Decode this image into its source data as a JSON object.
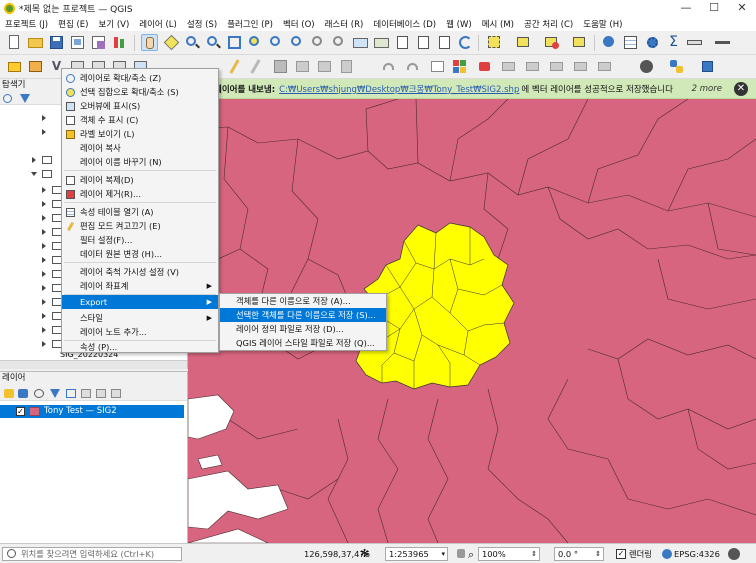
{
  "window": {
    "title": "*제목 없는 프로젝트 — QGIS"
  },
  "menubar": [
    "프로젝트 (J)",
    "편집 (E)",
    "보기 (V)",
    "레이어 (L)",
    "설정 (S)",
    "플러그인 (P)",
    "벡터 (O)",
    "래스터 (R)",
    "데이터베이스 (D)",
    "웹 (W)",
    "메시 (M)",
    "공간 처리 (C)",
    "도움말 (H)"
  ],
  "message": {
    "lead": "레이어를 내보냄:",
    "path": "C:₩Users₩shjung₩Desktop₩크몽₩Tony_Test₩SIG2.shp",
    "tail": "에 벡터 레이어를 성공적으로 저장했습니다",
    "more": "2 more"
  },
  "browser": {
    "title": "탐색기",
    "partial_item": "SIG_20220324"
  },
  "layers_panel": {
    "title": "레이어",
    "layer_name": "Tony Test — SIG2"
  },
  "context_menu": {
    "items": [
      "레이어로 확대/축소 (Z)",
      "선택 집합으로 확대/축소 (S)",
      "오버뷰에 표시(S)",
      "객체 수 표시 (C)",
      "라벨 보이기 (L)",
      "레이어 복사",
      "레이어 이름 바꾸기 (N)",
      "레이어 복제(D)",
      "레이어 제거(R)...",
      "속성 테이블 열기 (A)",
      "편집 모드 켜고끄기 (E)",
      "필터 설정(F)...",
      "데이터 원본 변경 (H)...",
      "레이어 축척 가시성 설정 (V)",
      "레이어 좌표계",
      "Export",
      "스타일",
      "레이어 노트 추가...",
      "속성 (P)..."
    ]
  },
  "export_submenu": {
    "items": [
      "객체를 다른 이름으로 저장 (A)...",
      "선택한 객체를 다른 이름으로 저장 (S)...",
      "레이어 정의 파일로 저장 (D)...",
      "QGIS 레이어 스타일 파일로 저장 (Q)..."
    ]
  },
  "statusbar": {
    "locate_placeholder": "위치를 찾으려면 입력하세요 (Ctrl+K)",
    "coordinate": "126,598,37,476",
    "scale": "1:253965",
    "magnifier": "100%",
    "rotation": "0.0 °",
    "render_label": "렌더링",
    "crs": "EPSG:4326"
  },
  "colors": {
    "map_fill": "#d8657f",
    "highlight_fill": "#ffff00",
    "selection": "#0078d7",
    "message_bg": "#d1e8b8"
  }
}
